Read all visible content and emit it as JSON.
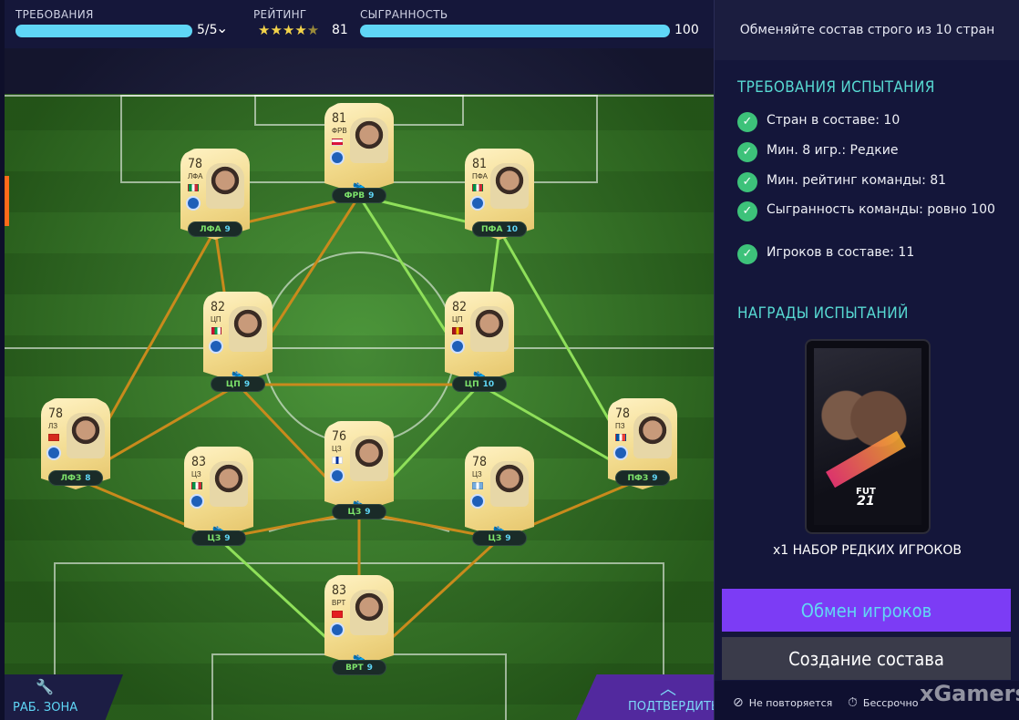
{
  "topbar": {
    "requirements_label": "ТРЕБОВАНИЯ",
    "requirements_value": "5/5",
    "requirements_progress": 1.0,
    "rating_label": "РЕЙТИНГ",
    "rating_stars": 4.5,
    "rating_value": "81",
    "chemistry_label": "СЫГРАННОСТЬ",
    "chemistry_value": "100",
    "chemistry_progress": 1.0
  },
  "players": [
    {
      "id": "st",
      "rating": "81",
      "pos": "ФРВ",
      "flag": [
        "#fff",
        "#dc143c"
      ],
      "chip_pos": "ФРВ",
      "chip_chem": "9"
    },
    {
      "id": "lf",
      "rating": "78",
      "pos": "ЛФА",
      "flag": [
        "#009246",
        "#fff",
        "#ce2b37"
      ],
      "chip_pos": "ЛФА",
      "chip_chem": "9"
    },
    {
      "id": "rf",
      "rating": "81",
      "pos": "ПФА",
      "flag": [
        "#009246",
        "#fff",
        "#ce2b37"
      ],
      "chip_pos": "ПФА",
      "chip_chem": "10"
    },
    {
      "id": "lcm",
      "rating": "82",
      "pos": "ЦП",
      "flag": [
        "#c8102e",
        "#00a651",
        "#fff"
      ],
      "chip_pos": "ЦП",
      "chip_chem": "9"
    },
    {
      "id": "rcm",
      "rating": "82",
      "pos": "ЦП",
      "flag": [
        "#aa151b",
        "#f1bf00",
        "#aa151b"
      ],
      "chip_pos": "ЦП",
      "chip_chem": "10"
    },
    {
      "id": "lb",
      "rating": "78",
      "pos": "ЛЗ",
      "flag": [
        "#d52b1e",
        "#d52b1e",
        "#d52b1e"
      ],
      "chip_pos": "ЛФЗ",
      "chip_chem": "8"
    },
    {
      "id": "cb_mid",
      "rating": "76",
      "pos": "ЦЗ",
      "flag": [
        "#ffffff",
        "#0033a0",
        "#fff"
      ],
      "chip_pos": "ЦЗ",
      "chip_chem": "9"
    },
    {
      "id": "rb",
      "rating": "78",
      "pos": "ПЗ",
      "flag": [
        "#0055a4",
        "#fff",
        "#ef4135"
      ],
      "chip_pos": "ПФЗ",
      "chip_chem": "9"
    },
    {
      "id": "lcb",
      "rating": "83",
      "pos": "ЦЗ",
      "flag": [
        "#009246",
        "#fff",
        "#ce2b37"
      ],
      "chip_pos": "ЦЗ",
      "chip_chem": "9"
    },
    {
      "id": "rcb",
      "rating": "78",
      "pos": "ЦЗ",
      "flag": [
        "#74acdf",
        "#fff",
        "#74acdf"
      ],
      "chip_pos": "ЦЗ",
      "chip_chem": "9"
    },
    {
      "id": "gk",
      "rating": "83",
      "pos": "ВРТ",
      "flag": [
        "#e41e20",
        "#e41e20",
        "#e41e20"
      ],
      "chip_pos": "ВРТ",
      "chip_chem": "9"
    }
  ],
  "links": [
    {
      "from": "lf",
      "to": "st",
      "strength": "orange"
    },
    {
      "from": "st",
      "to": "rf",
      "strength": "green"
    },
    {
      "from": "st",
      "to": "lcm",
      "strength": "orange"
    },
    {
      "from": "st",
      "to": "rcm",
      "strength": "green"
    },
    {
      "from": "lf",
      "to": "lcm",
      "strength": "orange"
    },
    {
      "from": "lf",
      "to": "lb",
      "strength": "orange"
    },
    {
      "from": "rf",
      "to": "rcm",
      "strength": "green"
    },
    {
      "from": "rf",
      "to": "rb",
      "strength": "green"
    },
    {
      "from": "lcm",
      "to": "rcm",
      "strength": "orange"
    },
    {
      "from": "lcm",
      "to": "lb",
      "strength": "orange"
    },
    {
      "from": "lcm",
      "to": "cb_mid",
      "strength": "orange"
    },
    {
      "from": "rcm",
      "to": "cb_mid",
      "strength": "green"
    },
    {
      "from": "rcm",
      "to": "rb",
      "strength": "green"
    },
    {
      "from": "lb",
      "to": "lcb",
      "strength": "orange"
    },
    {
      "from": "lcb",
      "to": "cb_mid",
      "strength": "orange"
    },
    {
      "from": "cb_mid",
      "to": "rcb",
      "strength": "orange"
    },
    {
      "from": "rcb",
      "to": "rb",
      "strength": "orange"
    },
    {
      "from": "lcb",
      "to": "gk",
      "strength": "green"
    },
    {
      "from": "cb_mid",
      "to": "gk",
      "strength": "orange"
    },
    {
      "from": "rcb",
      "to": "gk",
      "strength": "orange"
    }
  ],
  "link_colors": {
    "orange": "#c98a1c",
    "green": "#8fe05a"
  },
  "workspace": {
    "label": "РАБ. ЗОНА",
    "icon": "wrench-icon"
  },
  "confirm": {
    "label": "ПОДТВЕРДИТЬ",
    "icon": "chevron-up-icon"
  },
  "right": {
    "header": "Обменяйте состав строго из 10 стран",
    "req_title": "ТРЕБОВАНИЯ ИСПЫТАНИЯ",
    "requirements": [
      "Стран в составе: 10",
      "Мин. 8 игр.: Редкие",
      "Мин. рейтинг команды: 81",
      "Сыгранность команды: ровно 100",
      "Игроков в составе: 11"
    ],
    "rewards_title": "НАГРАДЫ ИСПЫТАНИЙ",
    "pack_logo_top": "FUT",
    "pack_logo_bottom": "21",
    "reward_label": "x1 НАБОР РЕДКИХ ИГРОКОВ",
    "swap_button": "Обмен игроков",
    "build_button": "Создание состава",
    "footer_left": "Не повторяется",
    "footer_right": "Бессрочно",
    "watermark": "xGamers"
  },
  "colors": {
    "accent": "#5fd6f6",
    "teal": "#57d9d2",
    "purple": "#7c3cf5",
    "check": "#3dc27a"
  }
}
